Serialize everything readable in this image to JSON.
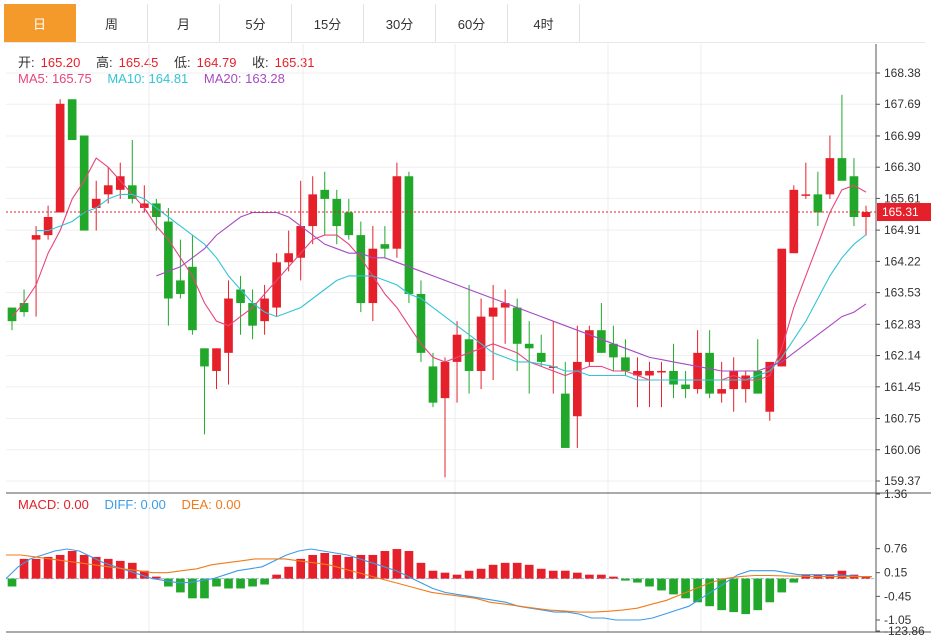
{
  "tabs": [
    {
      "label": "日",
      "active": true
    },
    {
      "label": "周",
      "active": false
    },
    {
      "label": "月",
      "active": false
    },
    {
      "label": "5分",
      "active": false
    },
    {
      "label": "15分",
      "active": false
    },
    {
      "label": "30分",
      "active": false
    },
    {
      "label": "60分",
      "active": false
    },
    {
      "label": "4时",
      "active": false
    }
  ],
  "quote": {
    "open_label": "开:",
    "open": "165.20",
    "high_label": "高:",
    "high": "165.45",
    "low_label": "低:",
    "low": "164.79",
    "close_label": "收:",
    "close": "165.31"
  },
  "ma": {
    "ma5_label": "MA5: 165.75",
    "ma10_label": "MA10: 164.81",
    "ma20_label": "MA20: 163.28"
  },
  "macd_legend": {
    "macd_label": "MACD: 0.00",
    "diff_label": "DIFF: 0.00",
    "dea_label": "DEA: 0.00"
  },
  "colors": {
    "up": "#e5202a",
    "down": "#21a82a",
    "ma5": "#e8457c",
    "ma10": "#33c4d6",
    "ma20": "#a64bc2",
    "diff": "#3d9be9",
    "dea": "#f07c1c",
    "tab_active": "#f49a2a",
    "price_line": "#e5202a"
  },
  "chart_data": [
    {
      "type": "candlestick",
      "title": "",
      "price_axis_ticks": [
        "168.38",
        "167.69",
        "166.99",
        "166.30",
        "165.61",
        "164.91",
        "164.22",
        "163.53",
        "162.83",
        "162.14",
        "161.45",
        "160.75",
        "160.06",
        "159.37"
      ],
      "ylim": [
        159.25,
        168.9
      ],
      "last_price_label": "165.31",
      "ohlc": [
        [
          163.2,
          163.2,
          162.7,
          162.9
        ],
        [
          163.3,
          163.6,
          163.0,
          163.1
        ],
        [
          164.7,
          165.0,
          163.0,
          164.8
        ],
        [
          164.8,
          165.45,
          164.7,
          165.2
        ],
        [
          165.3,
          167.8,
          165.3,
          167.7
        ],
        [
          167.8,
          167.8,
          166.9,
          166.9
        ],
        [
          167.0,
          167.0,
          164.9,
          164.9
        ],
        [
          165.4,
          166.0,
          164.9,
          165.6
        ],
        [
          165.7,
          166.3,
          165.5,
          165.9
        ],
        [
          165.8,
          166.4,
          165.6,
          166.1
        ],
        [
          165.9,
          166.9,
          165.5,
          165.6
        ],
        [
          165.4,
          165.9,
          165.3,
          165.5
        ],
        [
          165.5,
          165.6,
          164.9,
          165.2
        ],
        [
          165.1,
          165.4,
          162.8,
          163.4
        ],
        [
          163.8,
          164.7,
          163.4,
          163.5
        ],
        [
          164.1,
          164.8,
          162.6,
          162.7
        ],
        [
          162.3,
          162.3,
          160.4,
          161.9
        ],
        [
          161.8,
          162.3,
          161.4,
          162.3
        ],
        [
          162.2,
          163.8,
          161.5,
          163.4
        ],
        [
          163.6,
          163.9,
          162.6,
          163.3
        ],
        [
          163.3,
          163.6,
          162.5,
          162.8
        ],
        [
          162.9,
          163.7,
          162.6,
          163.4
        ],
        [
          163.2,
          164.4,
          163.0,
          164.2
        ],
        [
          164.2,
          164.9,
          164.0,
          164.4
        ],
        [
          164.3,
          166.0,
          163.8,
          165.0
        ],
        [
          165.0,
          166.1,
          164.6,
          165.7
        ],
        [
          165.8,
          166.2,
          164.8,
          165.6
        ],
        [
          165.6,
          165.8,
          164.6,
          165.0
        ],
        [
          165.3,
          165.6,
          164.7,
          164.8
        ],
        [
          164.8,
          165.1,
          163.1,
          163.3
        ],
        [
          163.3,
          165.0,
          162.9,
          164.5
        ],
        [
          164.6,
          165.0,
          164.3,
          164.5
        ],
        [
          164.5,
          166.4,
          164.3,
          166.1
        ],
        [
          166.1,
          166.2,
          163.3,
          163.5
        ],
        [
          163.5,
          163.8,
          162.0,
          162.2
        ],
        [
          161.9,
          162.2,
          161.0,
          161.1
        ],
        [
          161.2,
          162.1,
          159.45,
          162.0
        ],
        [
          162.0,
          162.9,
          161.1,
          162.6
        ],
        [
          162.5,
          163.7,
          161.3,
          161.8
        ],
        [
          161.8,
          163.4,
          161.4,
          163.0
        ],
        [
          163.0,
          163.7,
          161.6,
          163.2
        ],
        [
          163.2,
          163.6,
          162.4,
          163.3
        ],
        [
          163.2,
          163.4,
          161.8,
          162.4
        ],
        [
          162.4,
          162.9,
          161.3,
          162.3
        ],
        [
          162.2,
          162.6,
          161.9,
          162.0
        ],
        [
          161.9,
          162.9,
          161.3,
          161.9
        ],
        [
          161.3,
          162.0,
          160.3,
          160.1
        ],
        [
          160.8,
          162.8,
          160.1,
          162.0
        ],
        [
          162.0,
          162.8,
          161.9,
          162.7
        ],
        [
          162.7,
          163.3,
          162.2,
          162.2
        ],
        [
          162.4,
          162.8,
          161.8,
          162.1
        ],
        [
          162.1,
          162.5,
          161.7,
          161.8
        ],
        [
          161.7,
          162.1,
          161.0,
          161.8
        ],
        [
          161.7,
          162.0,
          161.0,
          161.8
        ],
        [
          161.8,
          162.0,
          161.0,
          161.8
        ],
        [
          161.8,
          162.4,
          161.2,
          161.5
        ],
        [
          161.5,
          161.8,
          161.2,
          161.4
        ],
        [
          161.4,
          162.7,
          161.3,
          162.2
        ],
        [
          162.2,
          162.7,
          161.2,
          161.3
        ],
        [
          161.3,
          162.0,
          161.1,
          161.4
        ],
        [
          161.4,
          162.1,
          160.9,
          161.8
        ],
        [
          161.4,
          161.8,
          161.1,
          161.7
        ],
        [
          161.8,
          162.5,
          161.3,
          161.3
        ],
        [
          160.9,
          162.0,
          160.7,
          162.0
        ],
        [
          161.9,
          164.4,
          161.9,
          164.5
        ],
        [
          164.4,
          165.9,
          164.4,
          165.8
        ],
        [
          165.7,
          166.4,
          165.6,
          165.7
        ],
        [
          165.7,
          166.2,
          165.0,
          165.3
        ],
        [
          165.7,
          167.0,
          165.6,
          166.5
        ],
        [
          166.5,
          167.9,
          166.3,
          166.0
        ],
        [
          166.1,
          166.5,
          165.0,
          165.2
        ],
        [
          165.2,
          165.45,
          164.79,
          165.31
        ]
      ],
      "ma5": [
        163.0,
        163.3,
        163.7,
        164.4,
        164.9,
        165.6,
        166.0,
        166.5,
        166.3,
        166.0,
        165.7,
        165.4,
        165.0,
        164.7,
        164.3,
        163.9,
        163.3,
        162.9,
        162.8,
        163.0,
        163.2,
        163.5,
        163.8,
        164.1,
        164.4,
        164.7,
        164.8,
        164.8,
        164.6,
        164.3,
        163.9,
        163.5,
        163.2,
        162.8,
        162.4,
        162.1,
        162.0,
        162.1,
        162.2,
        162.3,
        162.4,
        162.3,
        162.2,
        162.0,
        161.9,
        161.8,
        161.7,
        161.8,
        161.9,
        161.9,
        161.8,
        161.8,
        161.7,
        161.6,
        161.6,
        161.6,
        161.6,
        161.6,
        161.6,
        161.6,
        161.7,
        161.6,
        161.6,
        161.7,
        162.3,
        163.2,
        163.9,
        164.6,
        165.3,
        165.8,
        165.9,
        165.75
      ],
      "ma10": [
        164.9,
        164.9,
        165.0,
        165.1,
        165.3,
        165.4,
        165.6,
        165.7,
        165.7,
        165.6,
        165.4,
        165.2,
        165.0,
        164.8,
        164.6,
        164.3,
        163.9,
        163.6,
        163.3,
        163.1,
        163.0,
        163.1,
        163.2,
        163.4,
        163.6,
        163.8,
        163.9,
        163.9,
        163.9,
        163.8,
        163.7,
        163.5,
        163.4,
        163.2,
        163.0,
        162.8,
        162.6,
        162.4,
        162.2,
        162.1,
        162.0,
        162.0,
        161.95,
        161.9,
        161.8,
        161.8,
        161.7,
        161.7,
        161.7,
        161.7,
        161.6,
        161.6,
        161.6,
        161.6,
        161.6,
        161.6,
        161.6,
        161.6,
        161.6,
        161.6,
        161.7,
        161.8,
        162.1,
        162.5,
        162.9,
        163.4,
        163.9,
        164.3,
        164.6,
        164.81
      ],
      "ma20": [
        163.9,
        164.0,
        164.1,
        164.3,
        164.5,
        164.8,
        165.0,
        165.2,
        165.3,
        165.3,
        165.3,
        165.2,
        165.0,
        164.8,
        164.6,
        164.5,
        164.4,
        164.4,
        164.3,
        164.3,
        164.2,
        164.1,
        164.0,
        163.9,
        163.8,
        163.7,
        163.6,
        163.5,
        163.4,
        163.3,
        163.2,
        163.1,
        163.0,
        162.9,
        162.8,
        162.7,
        162.6,
        162.5,
        162.4,
        162.3,
        162.2,
        162.1,
        162.05,
        162.0,
        161.95,
        161.9,
        161.85,
        161.8,
        161.8,
        161.8,
        161.8,
        161.9,
        162.0,
        162.2,
        162.4,
        162.6,
        162.8,
        163.0,
        163.1,
        163.28
      ]
    },
    {
      "type": "macd",
      "axis_ticks": [
        "1.36",
        "0.76",
        "0.15",
        "-0.45",
        "-1.05",
        "-123.86"
      ],
      "ylim": [
        -1.36,
        1.45
      ],
      "histogram": [
        -0.2,
        0.5,
        0.5,
        0.55,
        0.6,
        0.7,
        0.6,
        0.55,
        0.5,
        0.45,
        0.4,
        0.2,
        0.05,
        -0.2,
        -0.35,
        -0.5,
        -0.5,
        -0.2,
        -0.25,
        -0.25,
        -0.2,
        -0.15,
        0.1,
        0.3,
        0.5,
        0.6,
        0.65,
        0.6,
        0.55,
        0.6,
        0.6,
        0.7,
        0.75,
        0.7,
        0.4,
        0.2,
        0.15,
        0.1,
        0.2,
        0.25,
        0.35,
        0.4,
        0.4,
        0.35,
        0.25,
        0.2,
        0.2,
        0.15,
        0.1,
        0.1,
        0.05,
        -0.05,
        -0.1,
        -0.2,
        -0.3,
        -0.4,
        -0.5,
        -0.6,
        -0.7,
        -0.8,
        -0.85,
        -0.9,
        -0.8,
        -0.6,
        -0.35,
        -0.1,
        0.1,
        0.1,
        0.1,
        0.2,
        0.1,
        0.05
      ],
      "diff": [
        0.0,
        0.3,
        0.5,
        0.6,
        0.7,
        0.75,
        0.7,
        0.55,
        0.4,
        0.3,
        0.2,
        0.1,
        0.0,
        -0.05,
        -0.1,
        -0.1,
        -0.05,
        0.0,
        0.1,
        0.2,
        0.25,
        0.3,
        0.45,
        0.6,
        0.7,
        0.75,
        0.7,
        0.65,
        0.6,
        0.5,
        0.4,
        0.3,
        0.2,
        0.05,
        -0.1,
        -0.25,
        -0.35,
        -0.4,
        -0.45,
        -0.5,
        -0.55,
        -0.6,
        -0.7,
        -0.75,
        -0.8,
        -0.85,
        -0.85,
        -0.9,
        -1.0,
        -1.0,
        -1.05,
        -1.05,
        -1.05,
        -1.0,
        -0.9,
        -0.8,
        -0.7,
        -0.5,
        -0.3,
        -0.1,
        0.1,
        0.2,
        0.2,
        0.2,
        0.15,
        0.1,
        0.1,
        0.1,
        0.1,
        0.08,
        0.05,
        0.05
      ],
      "dea": [
        0.6,
        0.6,
        0.55,
        0.5,
        0.45,
        0.4,
        0.35,
        0.3,
        0.25,
        0.2,
        0.15,
        0.15,
        0.2,
        0.25,
        0.35,
        0.4,
        0.45,
        0.5,
        0.5,
        0.5,
        0.45,
        0.4,
        0.35,
        0.25,
        0.15,
        0.05,
        -0.05,
        -0.15,
        -0.25,
        -0.35,
        -0.4,
        -0.45,
        -0.5,
        -0.6,
        -0.65,
        -0.7,
        -0.75,
        -0.8,
        -0.82,
        -0.85,
        -0.85,
        -0.83,
        -0.8,
        -0.75,
        -0.65,
        -0.55,
        -0.4,
        -0.25,
        -0.1,
        0.0,
        0.05,
        0.08,
        0.08,
        0.07,
        0.06,
        0.05,
        0.05,
        0.05,
        0.05,
        0.05
      ]
    }
  ]
}
